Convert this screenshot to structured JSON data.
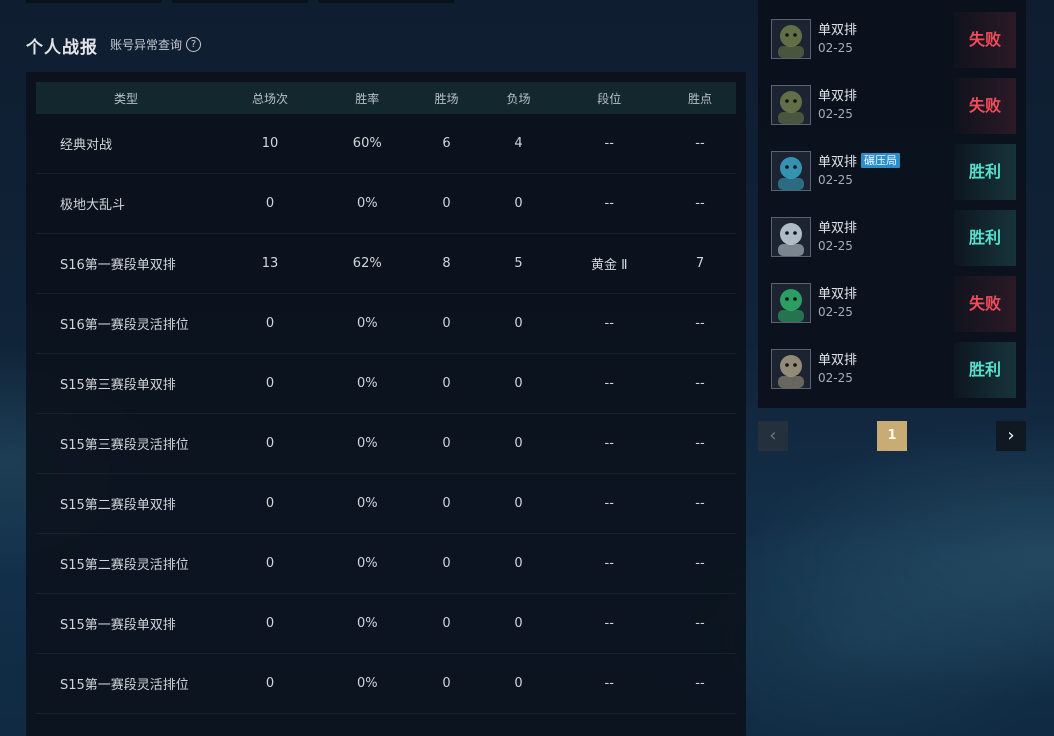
{
  "section": {
    "title": "个人战报",
    "anomaly_link": "账号异常查询",
    "help_glyph": "?"
  },
  "stats_table": {
    "headers": [
      "类型",
      "总场次",
      "胜率",
      "胜场",
      "负场",
      "段位",
      "胜点"
    ],
    "rows": [
      [
        "经典对战",
        "10",
        "60%",
        "6",
        "4",
        "--",
        "--"
      ],
      [
        "极地大乱斗",
        "0",
        "0%",
        "0",
        "0",
        "--",
        "--"
      ],
      [
        "S16第一赛段单双排",
        "13",
        "62%",
        "8",
        "5",
        "黄金 Ⅱ",
        "7"
      ],
      [
        "S16第一赛段灵活排位",
        "0",
        "0%",
        "0",
        "0",
        "--",
        "--"
      ],
      [
        "S15第三赛段单双排",
        "0",
        "0%",
        "0",
        "0",
        "--",
        "--"
      ],
      [
        "S15第三赛段灵活排位",
        "0",
        "0%",
        "0",
        "0",
        "--",
        "--"
      ],
      [
        "S15第二赛段单双排",
        "0",
        "0%",
        "0",
        "0",
        "--",
        "--"
      ],
      [
        "S15第二赛段灵活排位",
        "0",
        "0%",
        "0",
        "0",
        "--",
        "--"
      ],
      [
        "S15第一赛段单双排",
        "0",
        "0%",
        "0",
        "0",
        "--",
        "--"
      ],
      [
        "S15第一赛段灵活排位",
        "0",
        "0%",
        "0",
        "0",
        "--",
        "--"
      ]
    ]
  },
  "matches": [
    {
      "queue": "单双排",
      "date": "02-25",
      "result": "失败",
      "outcome": "loss",
      "badge": "",
      "avatar": "champion-avatar-icon",
      "avatar_color": "#6f7d4a"
    },
    {
      "queue": "单双排",
      "date": "02-25",
      "result": "失败",
      "outcome": "loss",
      "badge": "",
      "avatar": "champion-avatar-icon",
      "avatar_color": "#6f7d4a"
    },
    {
      "queue": "单双排",
      "date": "02-25",
      "result": "胜利",
      "outcome": "win",
      "badge": "碾压局",
      "avatar": "champion-avatar-icon",
      "avatar_color": "#3aa7c8"
    },
    {
      "queue": "单双排",
      "date": "02-25",
      "result": "胜利",
      "outcome": "win",
      "badge": "",
      "avatar": "champion-avatar-icon",
      "avatar_color": "#c9d6e0"
    },
    {
      "queue": "单双排",
      "date": "02-25",
      "result": "失败",
      "outcome": "loss",
      "badge": "",
      "avatar": "champion-avatar-icon",
      "avatar_color": "#2fb46a"
    },
    {
      "queue": "单双排",
      "date": "02-25",
      "result": "胜利",
      "outcome": "win",
      "badge": "",
      "avatar": "champion-avatar-icon",
      "avatar_color": "#a89c84"
    }
  ],
  "pagination": {
    "current_page": "1",
    "prev_glyph": "‹",
    "next_glyph": "›"
  },
  "colors": {
    "loss": "#f04c5c",
    "win": "#57e0cd",
    "page_active": "#c9ac73",
    "badge": "#2a8ec9"
  }
}
